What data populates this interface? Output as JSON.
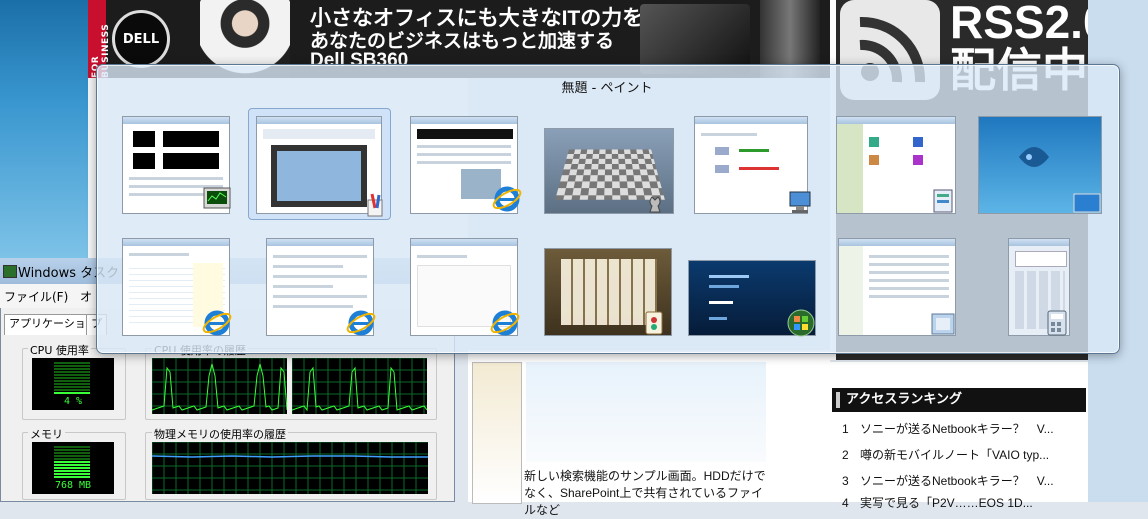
{
  "background": {
    "ad": {
      "brand": "DELL",
      "side_text": "FOR BUSINESS",
      "line1": "小さなオフィスにも大きなITの力を",
      "line2": "あなたのビジネスはもっと加速する",
      "line3": "Dell SB360"
    },
    "rss_banner": "RSS2.0 配信中",
    "ranking": {
      "title": "アクセスランキング",
      "items": [
        {
          "num": "1",
          "text": "ソニーが送るNetbookキラー？　V..."
        },
        {
          "num": "2",
          "text": "噂の新モバイルノート「VAIO typ..."
        },
        {
          "num": "3",
          "text": "ソニーが送るNetbookキラー？　V..."
        },
        {
          "num": "4",
          "text": "実写で見る「P2V……EOS 1D..."
        }
      ]
    },
    "article_caption": "新しい検索機能のサンプル画面。HDDだけでなく、SharePoint上で共有されているファイルなど"
  },
  "task_manager": {
    "title": "Windows タスク",
    "menu": [
      "ファイル(F)",
      "オ"
    ],
    "tabs": [
      "アプリケーション",
      "プ"
    ],
    "cpu_label": "CPU 使用率",
    "cpu_value": "4 %",
    "cpu_history_label": "CPU 使用率の履歴",
    "mem_label": "メモリ",
    "mem_value": "768 MB",
    "mem_history_label": "物理メモリの使用率の履歴",
    "cpu_fraction": 0.04
  },
  "switcher": {
    "title": "無題 - ペイント",
    "windows": [
      {
        "name": "task-manager",
        "icon": "task-manager-icon"
      },
      {
        "name": "paint",
        "icon": "paint-icon",
        "selected": true
      },
      {
        "name": "internet-explorer-1",
        "icon": "internet-explorer-icon"
      },
      {
        "name": "chess-titans",
        "icon": "chess-icon"
      },
      {
        "name": "network-center",
        "icon": "network-icon"
      },
      {
        "name": "control-panel",
        "icon": "control-panel-icon"
      },
      {
        "name": "desktop",
        "icon": "desktop-icon"
      },
      {
        "name": "internet-explorer-2",
        "icon": "internet-explorer-icon"
      },
      {
        "name": "internet-explorer-3",
        "icon": "internet-explorer-icon"
      },
      {
        "name": "internet-explorer-4",
        "icon": "internet-explorer-icon"
      },
      {
        "name": "mahjong-titans",
        "icon": "mahjong-icon"
      },
      {
        "name": "windows-media-center",
        "icon": "windows-logo-icon"
      },
      {
        "name": "explorer-window",
        "icon": "folder-icon"
      },
      {
        "name": "calculator",
        "icon": "calculator-icon"
      }
    ]
  }
}
